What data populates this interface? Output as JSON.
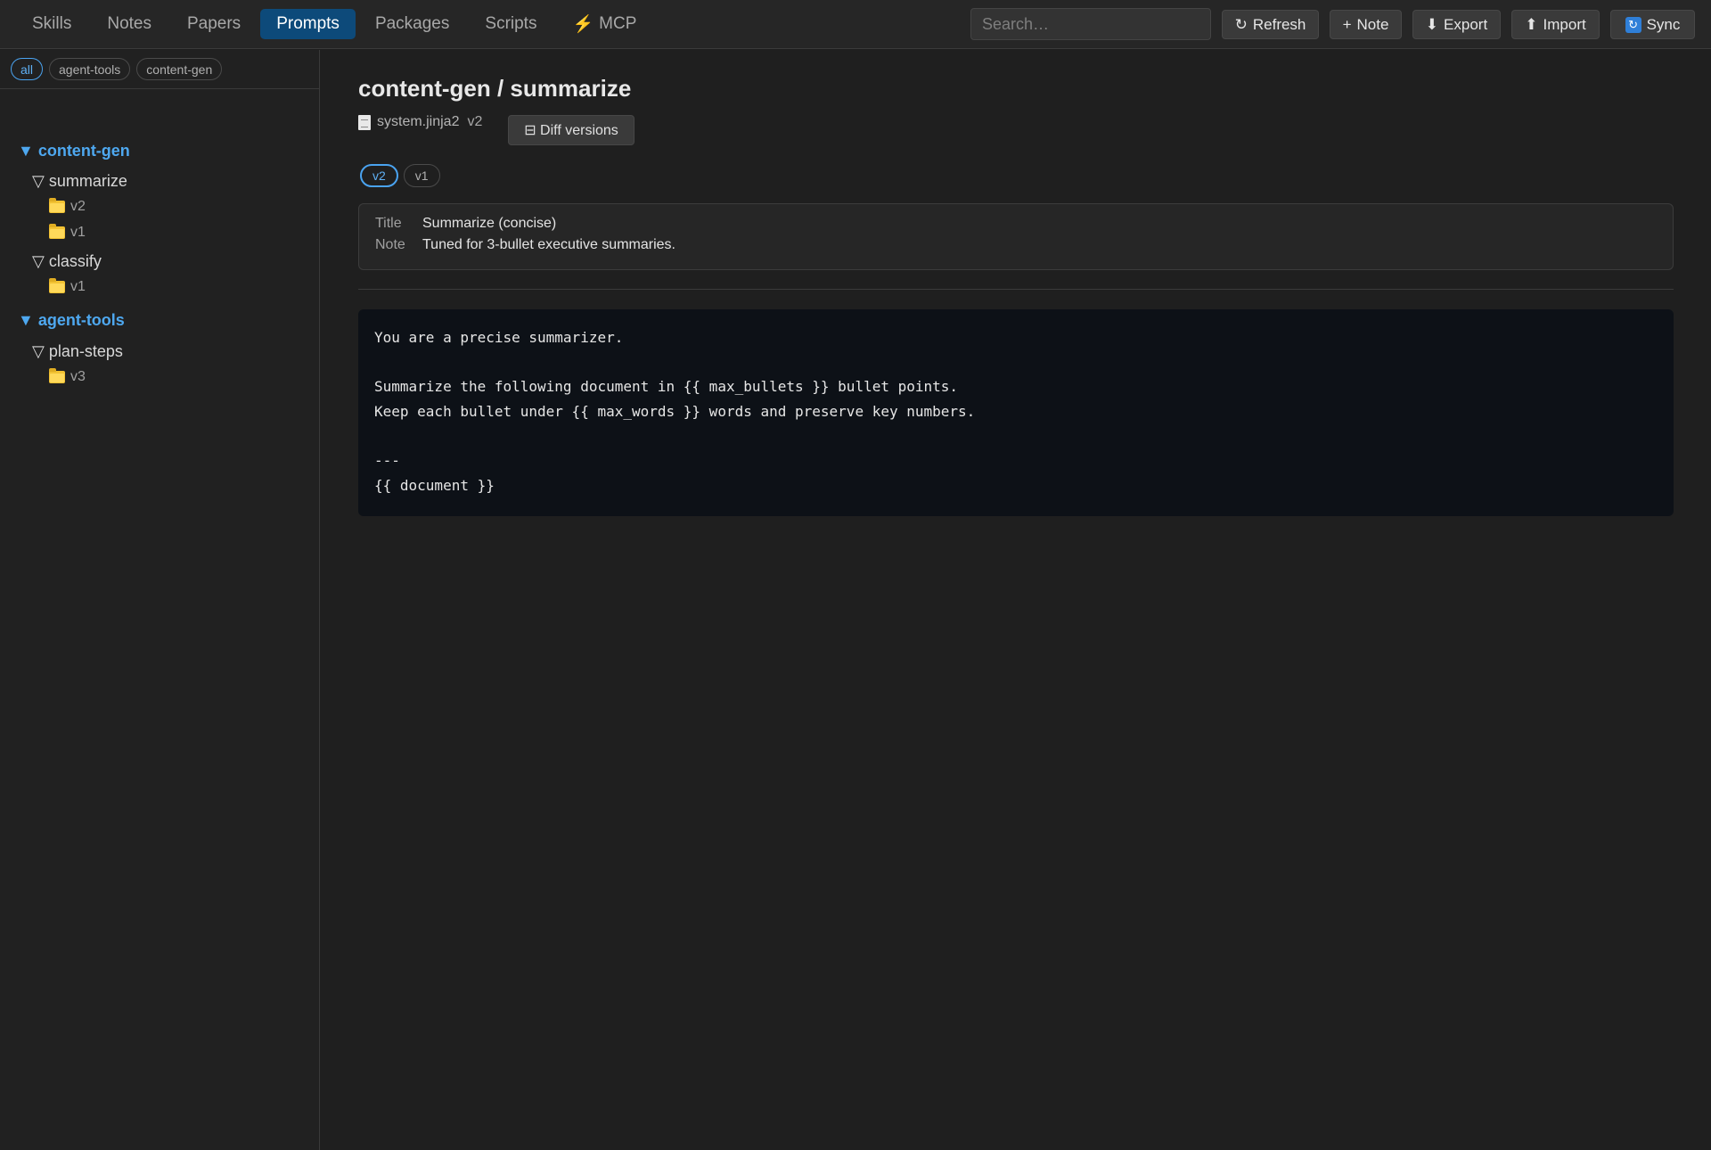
{
  "nav": {
    "tabs": [
      {
        "label": "Skills"
      },
      {
        "label": "Notes"
      },
      {
        "label": "Papers"
      },
      {
        "label": "Prompts",
        "active": true
      },
      {
        "label": "Packages"
      },
      {
        "label": "Scripts"
      },
      {
        "label": "MCP",
        "icon": "lightning-icon"
      }
    ],
    "search_placeholder": "Search…",
    "buttons": {
      "refresh": {
        "icon": "↻",
        "label": "Refresh"
      },
      "note": {
        "icon": "+",
        "label": "Note"
      },
      "export": {
        "icon": "⬇",
        "label": "Export"
      },
      "import": {
        "icon": "⬆",
        "label": "Import"
      },
      "sync": {
        "icon": "↻",
        "label": "Sync"
      }
    }
  },
  "sidebar": {
    "filters": [
      {
        "label": "all",
        "active": true
      },
      {
        "label": "agent-tools"
      },
      {
        "label": "content-gen"
      }
    ],
    "tree": {
      "content_gen": {
        "label": "▼ content-gen",
        "summarize": {
          "label": "▽ summarize",
          "versions": [
            "v2",
            "v1"
          ]
        },
        "classify": {
          "label": "▽ classify",
          "versions": [
            "v1"
          ]
        }
      },
      "agent_tools": {
        "label": "▼ agent-tools",
        "plan_steps": {
          "label": "▽ plan-steps",
          "versions": [
            "v3"
          ]
        }
      }
    }
  },
  "main": {
    "title": "content-gen / summarize",
    "file": "system.jinja2",
    "version": "v2",
    "diff_button": "⊟ Diff versions",
    "version_chips": [
      {
        "label": "v2",
        "active": true
      },
      {
        "label": "v1"
      }
    ],
    "meta": {
      "title_key": "Title",
      "title_value": "Summarize (concise)",
      "note_key": "Note",
      "note_value": "Tuned for 3-bullet executive summaries."
    },
    "code": "You are a precise summarizer.\n\nSummarize the following document in {{ max_bullets }} bullet points.\nKeep each bullet under {{ max_words }} words and preserve key numbers.\n\n---\n{{ document }}"
  },
  "colors": {
    "accent": "#4ea8f0",
    "active_tab": "#0d4a7a",
    "code_bg": "#0d1117",
    "folder": "#f2c233"
  }
}
